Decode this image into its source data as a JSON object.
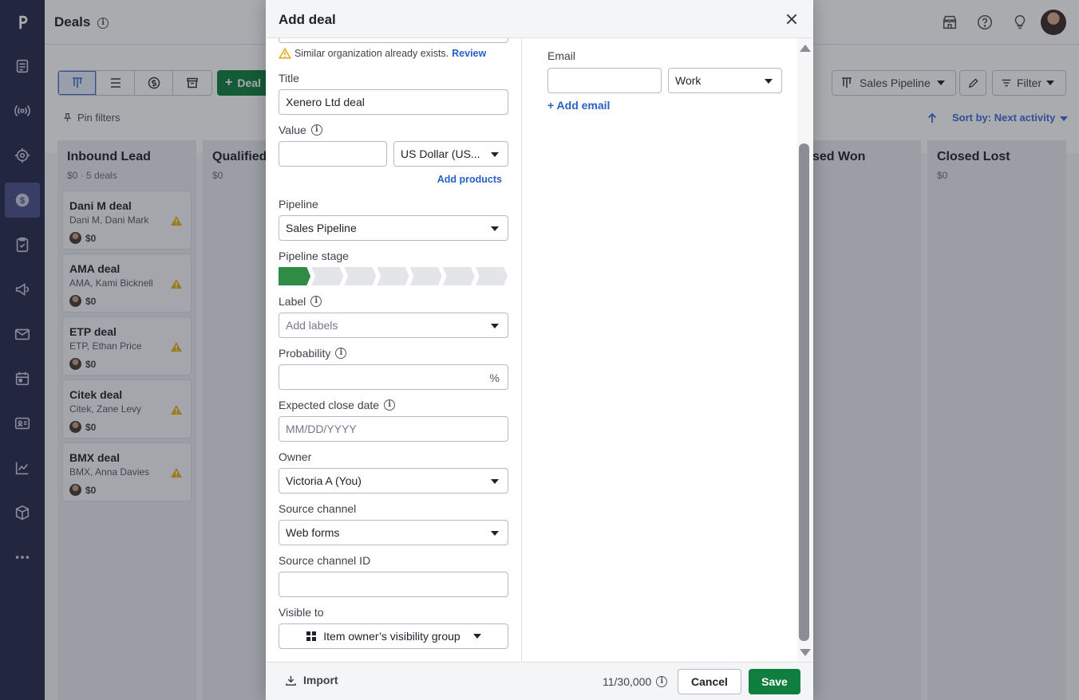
{
  "app": {
    "page_title": "Deals"
  },
  "toolbar": {
    "deal_button_label": "Deal",
    "pin_filters_label": "Pin filters",
    "pipeline_label": "Sales Pipeline",
    "filter_label": "Filter",
    "sort_label": "Sort by: Next activity"
  },
  "board": {
    "stages": [
      {
        "title": "Inbound Lead",
        "sub": "$0 · 5 deals"
      },
      {
        "title": "Qualified",
        "sub": "$0"
      },
      {
        "title": "sed Won",
        "sub": ""
      },
      {
        "title": "Closed Lost",
        "sub": "$0"
      }
    ],
    "deals": [
      {
        "name": "Dani M deal",
        "people": "Dani M, Dani Mark",
        "value": "$0"
      },
      {
        "name": "AMA deal",
        "people": "AMA, Kami Bicknell",
        "value": "$0"
      },
      {
        "name": "ETP deal",
        "people": "ETP, Ethan Price",
        "value": "$0"
      },
      {
        "name": "Citek deal",
        "people": "Citek, Zane Levy",
        "value": "$0"
      },
      {
        "name": "BMX deal",
        "people": "BMX, Anna Davies",
        "value": "$0"
      }
    ]
  },
  "modal": {
    "title": "Add deal",
    "warning_text": "Similar organization already exists.",
    "warning_link": "Review",
    "title_label": "Title",
    "title_value": "Xenero Ltd deal",
    "value_label": "Value",
    "value_amount": "",
    "currency_value": "US Dollar (US...",
    "add_products_label": "Add products",
    "pipeline_label": "Pipeline",
    "pipeline_value": "Sales Pipeline",
    "pipeline_stage_label": "Pipeline stage",
    "pipeline_stage_current": 1,
    "pipeline_stage_count": 7,
    "label_label": "Label",
    "label_placeholder": "Add labels",
    "probability_label": "Probability",
    "probability_unit": "%",
    "close_date_label": "Expected close date",
    "close_date_placeholder": "MM/DD/YYYY",
    "owner_label": "Owner",
    "owner_value": "Victoria A (You)",
    "source_channel_label": "Source channel",
    "source_channel_value": "Web forms",
    "source_channel_id_label": "Source channel ID",
    "visible_to_label": "Visible to",
    "visible_to_value": "Item owner’s visibility group",
    "email_label": "Email",
    "email_type_value": "Work",
    "add_email_label": "+ Add email",
    "import_label": "Import",
    "counter_text": "11/30,000",
    "cancel_label": "Cancel",
    "save_label": "Save"
  },
  "colors": {
    "sidebar": "#26294a",
    "primary_green": "#107e3e",
    "link_blue": "#2861c5",
    "stage_active": "#2f8c46"
  }
}
